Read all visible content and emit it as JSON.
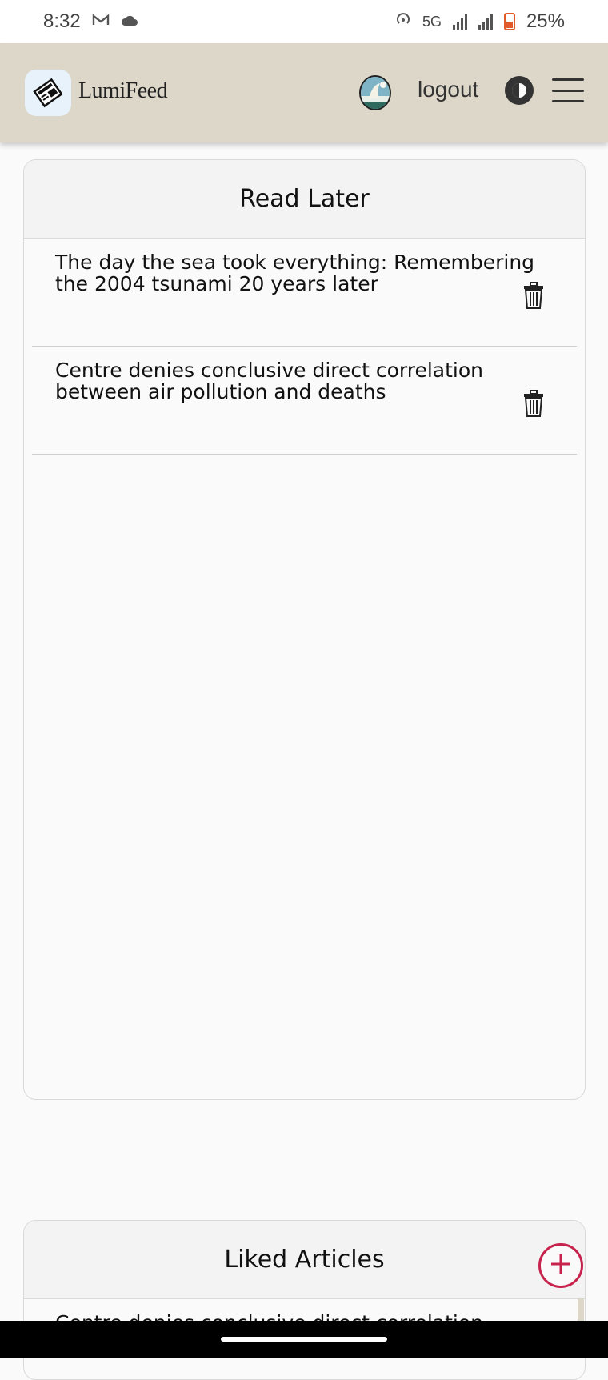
{
  "status_bar": {
    "time": "8:32",
    "network": "5G",
    "battery": "25%",
    "icons": [
      "gmail-icon",
      "cloud-icon",
      "hotspot-icon",
      "signal-icon",
      "signal-icon",
      "battery-icon"
    ]
  },
  "header": {
    "brand": "LumiFeed",
    "logout_label": "logout",
    "colors": {
      "background": "#dcd7c8"
    }
  },
  "read_later": {
    "title": "Read Later",
    "items": [
      {
        "title": "The day the sea took everything: Remembering the 2004 tsunami 20 years later"
      },
      {
        "title": "Centre denies conclusive direct correlation between air pollution and deaths"
      }
    ]
  },
  "liked_articles": {
    "title": "Liked Articles",
    "items": [
      {
        "title": "Centre denies conclusive direct correlation"
      }
    ]
  },
  "fab": {
    "icon": "plus-icon",
    "color": "#c8234d"
  }
}
